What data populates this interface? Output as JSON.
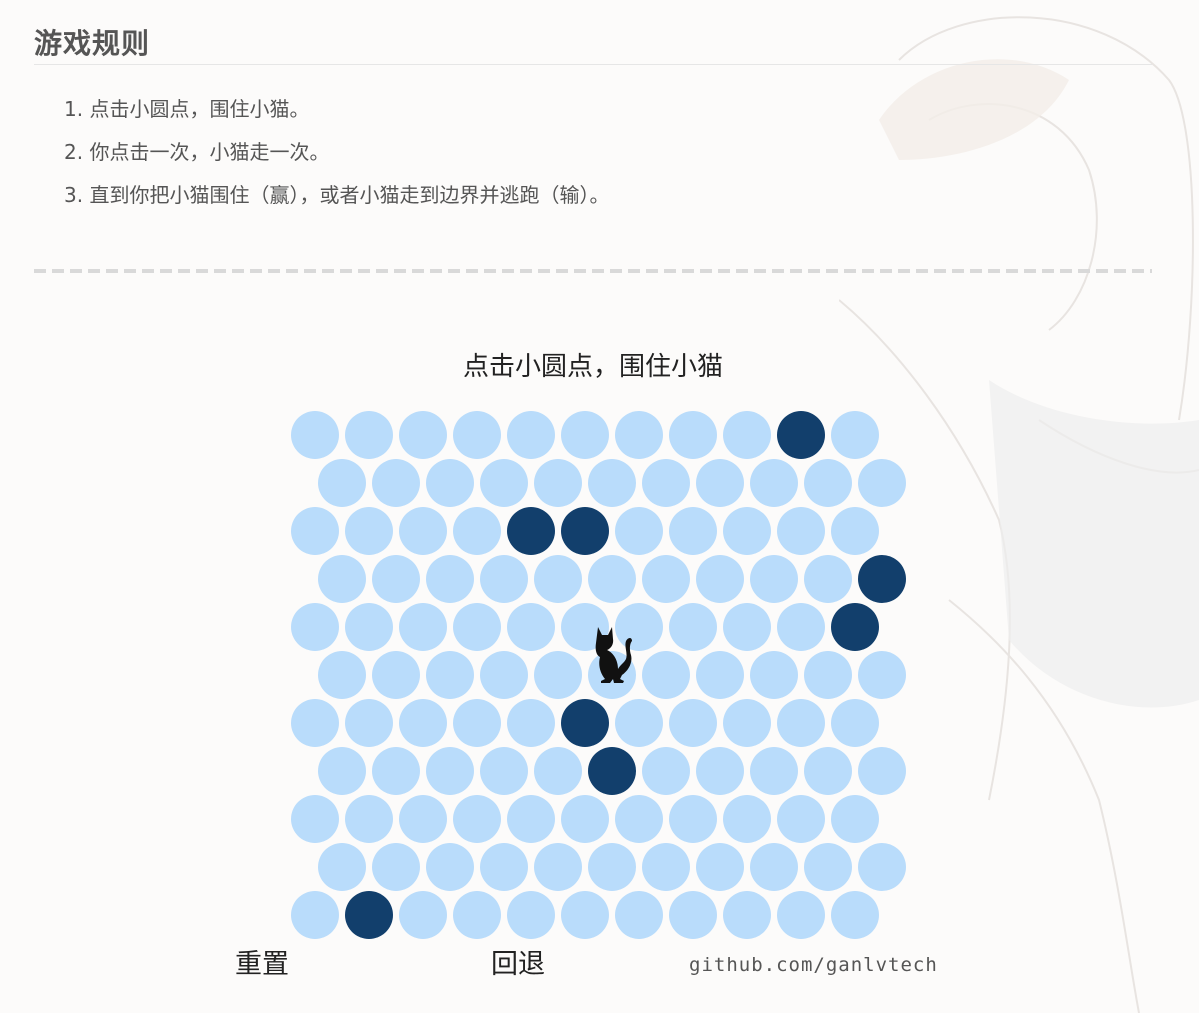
{
  "rules": {
    "title": "游戏规则",
    "items": [
      "1. 点击小圆点，围住小猫。",
      "2. 你点击一次，小猫走一次。",
      "3. 直到你把小猫围住（赢），或者小猫走到边界并逃跑（输）。"
    ]
  },
  "game": {
    "caption": "点击小圆点，围住小猫",
    "rows": 11,
    "cols": 11,
    "walls": [
      [
        0,
        9
      ],
      [
        2,
        4
      ],
      [
        2,
        5
      ],
      [
        3,
        10
      ],
      [
        4,
        10
      ],
      [
        6,
        5
      ],
      [
        7,
        5
      ],
      [
        10,
        1
      ]
    ],
    "cat": [
      5,
      5
    ],
    "colors": {
      "empty": "#b9dcfb",
      "wall": "#123f6c",
      "cat": "#111111"
    }
  },
  "controls": {
    "reset_label": "重置",
    "undo_label": "回退"
  },
  "credit": "github.com/ganlvtech"
}
